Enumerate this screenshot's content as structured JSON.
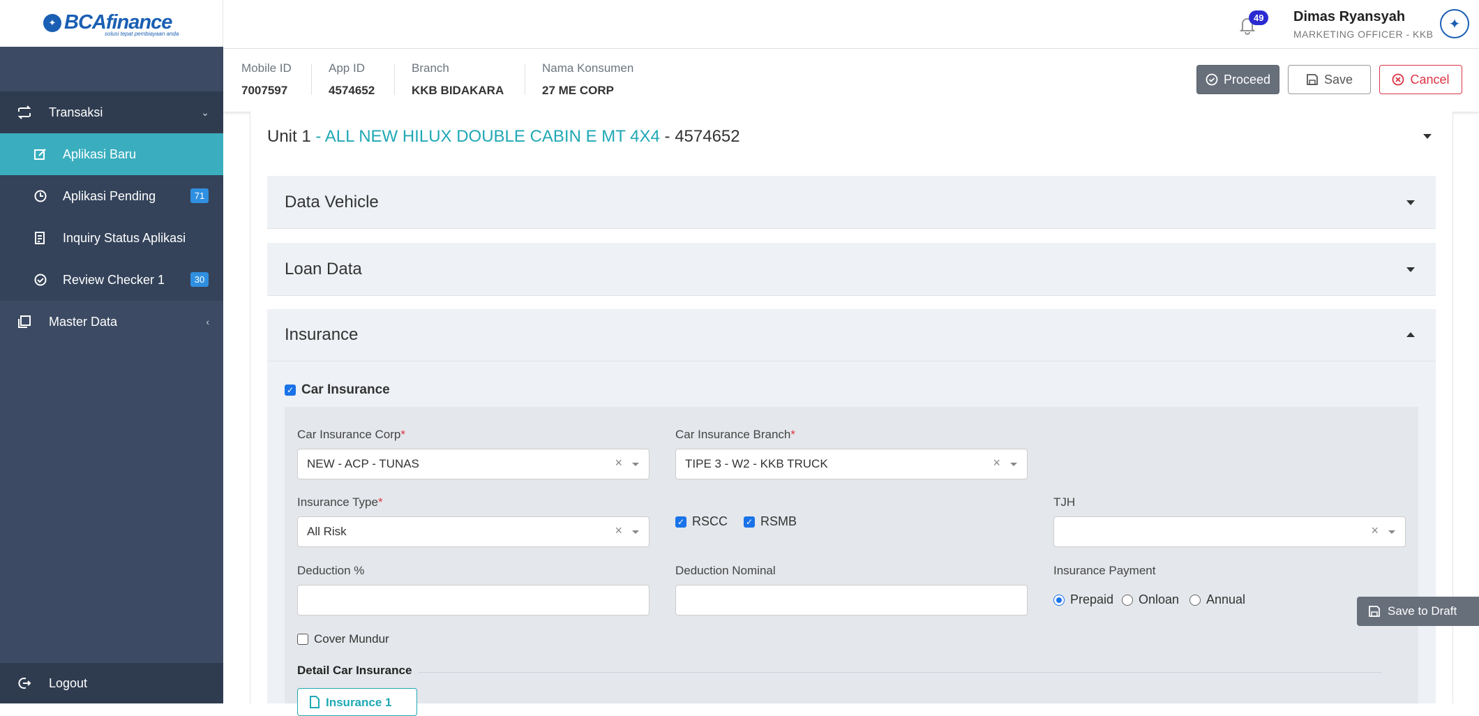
{
  "brand": {
    "name": "BCAfinance",
    "tagline": "solusi tepat pembiayaan anda"
  },
  "sidebar": {
    "groups": [
      {
        "label": "Transaksi",
        "icon": "exchange-icon"
      },
      {
        "label": "Master Data",
        "icon": "copy-icon"
      }
    ],
    "items": [
      {
        "label": "Aplikasi Baru",
        "icon": "edit-icon",
        "active": true
      },
      {
        "label": "Aplikasi Pendings",
        "icon": "clock-icon",
        "badge": "71"
      },
      {
        "label": "Inquiry Status Aplikasi",
        "icon": "document-list-icon"
      },
      {
        "label": "Review Checker 1",
        "icon": "check-circle-icon",
        "badge": "30"
      }
    ],
    "logout_label": "Logout"
  },
  "header": {
    "notification_count": "49",
    "user_name": "Dimas Ryansyah",
    "user_role": "MARKETING OFFICER - KKB"
  },
  "info": {
    "mobile_id_label": "Mobile ID",
    "mobile_id": "7007597",
    "app_id_label": "App ID",
    "app_id": "4574652",
    "branch_label": "Branch",
    "branch": "KKB BIDAKARA",
    "consumer_label": "Nama Konsumen",
    "consumer": "27 ME CORP"
  },
  "actions": {
    "proceed": "Proceed",
    "save": "Save",
    "cancel": "Cancel",
    "save_draft": "Save to Draft"
  },
  "unit": {
    "prefix": "Unit 1",
    "model": " - ALL NEW HILUX DOUBLE CABIN E MT 4X4",
    "suffix": " - 4574652"
  },
  "sections": {
    "vehicle": "Data Vehicle",
    "loan": "Loan Data",
    "insurance": "Insurance"
  },
  "insurance": {
    "car_insurance_label": "Car Insurance",
    "corp_label": "Car Insurance Corp",
    "corp_value": "NEW - ACP - TUNAS",
    "branch_label": "Car Insurance Branch",
    "branch_value": "TIPE 3 - W2 - KKB TRUCK",
    "type_label": "Insurance Type",
    "type_value": "All Risk",
    "rscc_label": "RSCC",
    "rsmb_label": "RSMB",
    "tjh_label": "TJH",
    "tjh_value": "",
    "deduction_pct_label": "Deduction %",
    "deduction_pct_value": "",
    "deduction_nominal_label": "Deduction Nominal",
    "deduction_nominal_value": "",
    "payment_label": "Insurance Payment",
    "payment_options": [
      "Prepaid",
      "Onloan",
      "Annual"
    ],
    "payment_selected": "Prepaid",
    "cover_mundur_label": "Cover Mundur",
    "detail_title": "Detail Car Insurance",
    "tab_label": "Insurance 1"
  },
  "colors": {
    "accent": "#3aaebe",
    "sidebar": "#3c4b63",
    "primary": "#1a73e8",
    "danger": "#dc3545"
  }
}
